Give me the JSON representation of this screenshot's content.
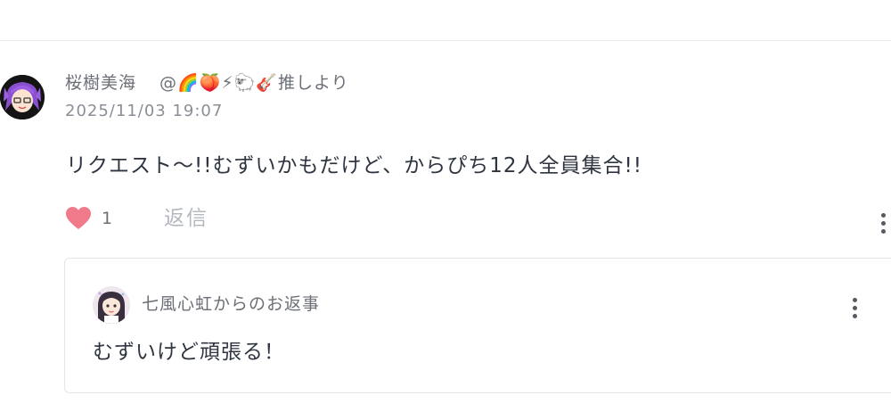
{
  "comment": {
    "author": "桜樹美海",
    "handle": "@🌈🍑⚡🐑🎸推しより",
    "timestamp": "2025/11/03 19:07",
    "body": "リクエスト〜!!むずいかもだけど、からぴち12人全員集合!!",
    "like_count": "1",
    "reply_label": "返信",
    "like_icon": "heart-icon",
    "menu_icon": "more-vertical-icon"
  },
  "reply": {
    "header": "七風心虹からのお返事",
    "body": "むずいけど頑張る！",
    "menu_icon": "more-vertical-icon"
  },
  "colors": {
    "heart": "#f07a8a",
    "text_primary": "#2f3540",
    "text_secondary": "#6b6f76",
    "reply_label": "#b3b8c0",
    "divider": "#e9ebee",
    "card_border": "#e3e6e8"
  }
}
